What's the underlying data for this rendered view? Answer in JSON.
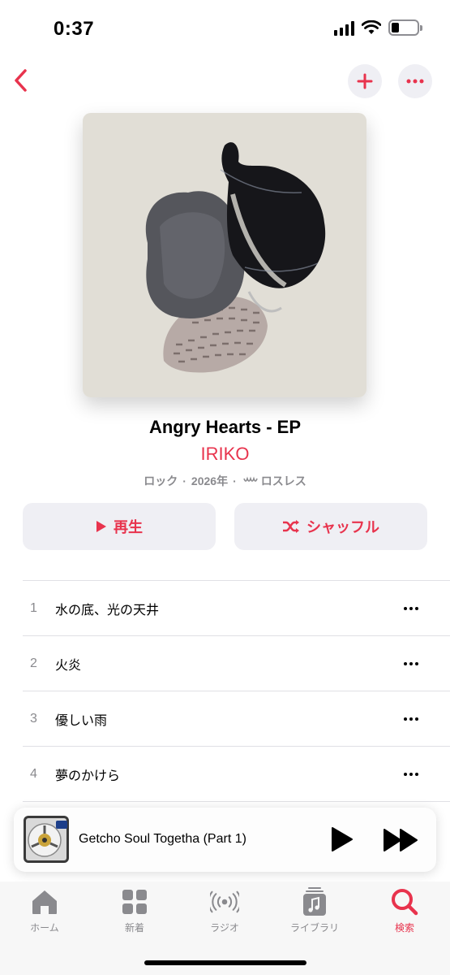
{
  "status_bar": {
    "time": "0:37"
  },
  "nav": {
    "back_icon": "chevron-left-icon",
    "add_icon": "plus-icon",
    "more_icon": "ellipsis-icon"
  },
  "album": {
    "title": "Angry Hearts - EP",
    "artist": "IRIKO",
    "genre": "ロック",
    "year": "2026年",
    "separator": "·",
    "quality": "ロスレス"
  },
  "actions": {
    "play_label": "再生",
    "shuffle_label": "シャッフル"
  },
  "tracks": [
    {
      "number": "1",
      "title": "水の底、光の天井"
    },
    {
      "number": "2",
      "title": "火炎"
    },
    {
      "number": "3",
      "title": "優しい雨"
    },
    {
      "number": "4",
      "title": "夢のかけら"
    }
  ],
  "now_playing": {
    "title": "Getcho Soul Togetha (Part 1)"
  },
  "tabs": [
    {
      "label": "ホーム",
      "icon": "home-icon"
    },
    {
      "label": "新着",
      "icon": "grid-icon"
    },
    {
      "label": "ラジオ",
      "icon": "radio-icon"
    },
    {
      "label": "ライブラリ",
      "icon": "library-icon"
    },
    {
      "label": "検索",
      "icon": "search-icon",
      "active": true
    }
  ],
  "colors": {
    "accent": "#e8334d",
    "secondary_text": "#8a8a8e",
    "button_bg": "#efeff4"
  }
}
